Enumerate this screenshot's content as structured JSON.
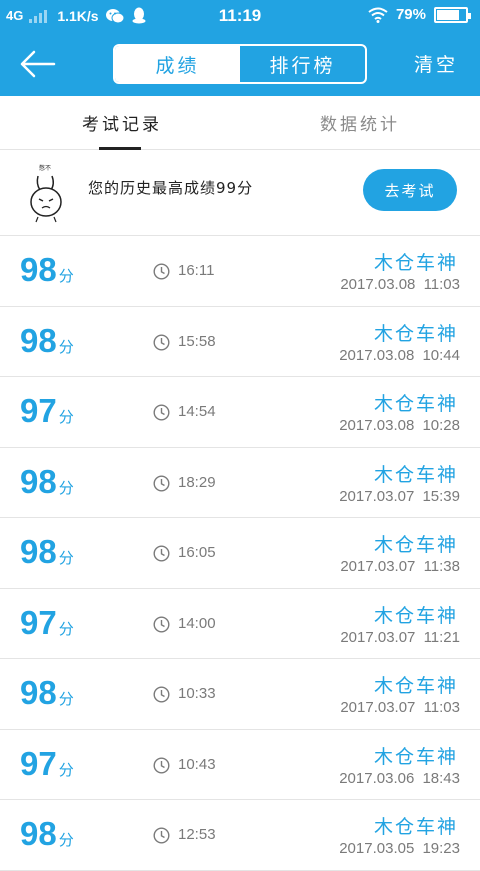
{
  "status_bar": {
    "network": "4G",
    "speed": "1.1K/s",
    "time": "11:19",
    "battery": "79%",
    "battery_level": 0.79
  },
  "nav": {
    "tabs": [
      "成绩",
      "排行榜"
    ],
    "active_tab": 0,
    "clear_label": "清空"
  },
  "sub_tabs": [
    "考试记录",
    "数据统计"
  ],
  "best": {
    "mascot_caption": "憋不",
    "text": "您的历史最高成绩99分",
    "button": "去考试"
  },
  "score_unit": "分",
  "records": [
    {
      "score": "98",
      "duration": "16:11",
      "name": "木仓车神",
      "date": "2017.03.08  11:03"
    },
    {
      "score": "98",
      "duration": "15:58",
      "name": "木仓车神",
      "date": "2017.03.08  10:44"
    },
    {
      "score": "97",
      "duration": "14:54",
      "name": "木仓车神",
      "date": "2017.03.08  10:28"
    },
    {
      "score": "98",
      "duration": "18:29",
      "name": "木仓车神",
      "date": "2017.03.07  15:39"
    },
    {
      "score": "98",
      "duration": "16:05",
      "name": "木仓车神",
      "date": "2017.03.07  11:38"
    },
    {
      "score": "97",
      "duration": "14:00",
      "name": "木仓车神",
      "date": "2017.03.07  11:21"
    },
    {
      "score": "98",
      "duration": "10:33",
      "name": "木仓车神",
      "date": "2017.03.07  11:03"
    },
    {
      "score": "97",
      "duration": "10:43",
      "name": "木仓车神",
      "date": "2017.03.06  18:43"
    },
    {
      "score": "98",
      "duration": "12:53",
      "name": "木仓车神",
      "date": "2017.03.05  19:23"
    }
  ],
  "colors": {
    "primary": "#22a3e2",
    "text_dark": "#222222",
    "text_gray": "#7a7a7a"
  }
}
